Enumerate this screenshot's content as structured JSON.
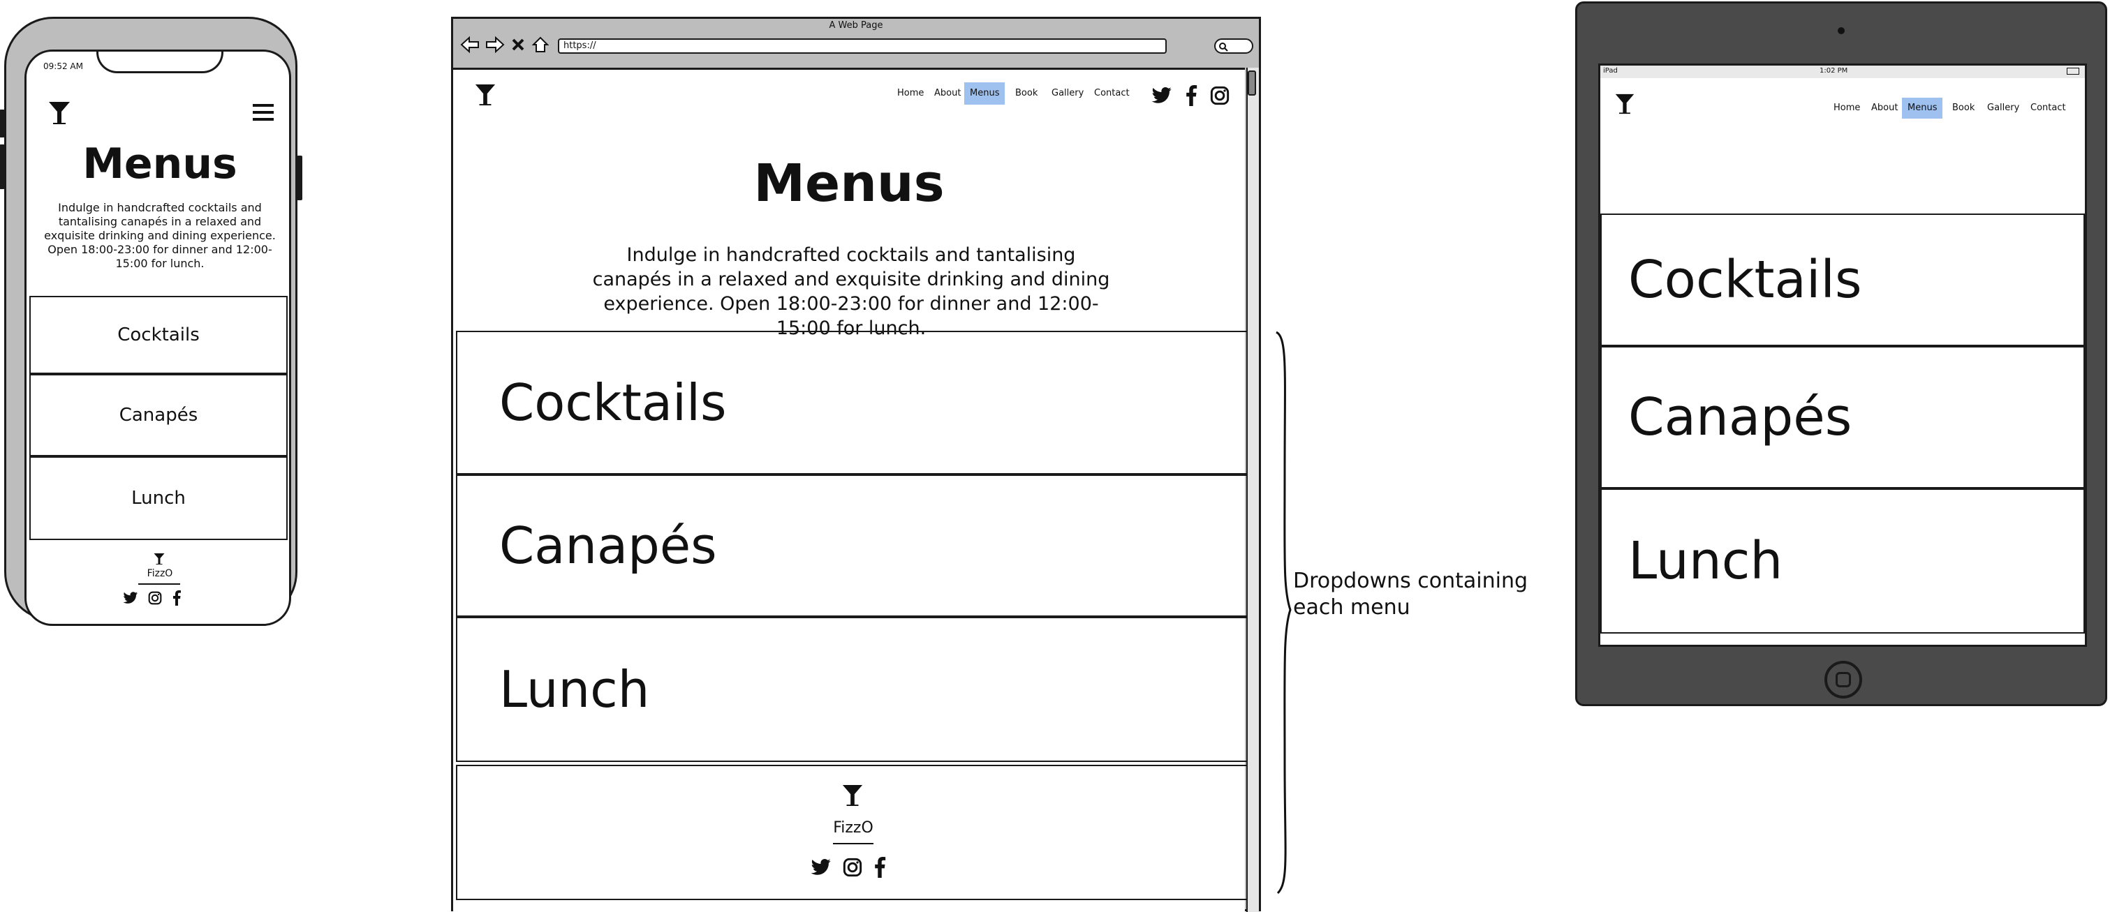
{
  "phone": {
    "status_time": "09:52 AM",
    "title": "Menus",
    "intro": "Indulge in handcrafted cocktails and tantalising canapés in a relaxed and exquisite drinking and dining experience. Open 18:00-23:00 for dinner and 12:00-15:00 for lunch.",
    "menus": [
      "Cocktails",
      "Canapés",
      "Lunch"
    ],
    "footer_brand": "FizzO",
    "icons": [
      "cocktail-glass-icon",
      "hamburger-menu-icon",
      "twitter-icon",
      "instagram-icon",
      "facebook-icon"
    ]
  },
  "browser": {
    "window_title": "A Web Page",
    "url": "https://",
    "nav": [
      "Home",
      "About",
      "Menus",
      "Book",
      "Gallery",
      "Contact"
    ],
    "active_nav": "Menus",
    "title": "Menus",
    "intro": "Indulge in handcrafted cocktails and tantalising canapés in a relaxed and exquisite drinking and dining experience. Open 18:00-23:00 for dinner and 12:00-15:00 for lunch.",
    "menus": [
      "Cocktails",
      "Canapés",
      "Lunch"
    ],
    "footer_brand": "FizzO",
    "social_icons": [
      "twitter-icon",
      "facebook-icon",
      "instagram-icon"
    ]
  },
  "annotation": {
    "text": "Dropdowns containing each menu"
  },
  "tablet": {
    "status_device": "iPad",
    "status_time": "1:02 PM",
    "nav": [
      "Home",
      "About",
      "Menus",
      "Book",
      "Gallery",
      "Contact"
    ],
    "active_nav": "Menus",
    "menus": [
      "Cocktails",
      "Canapés",
      "Lunch"
    ]
  },
  "colors": {
    "active_nav": "#9ec1f0",
    "device_frame": "#4a4a4a",
    "browser_chrome": "#bdbdbd"
  }
}
